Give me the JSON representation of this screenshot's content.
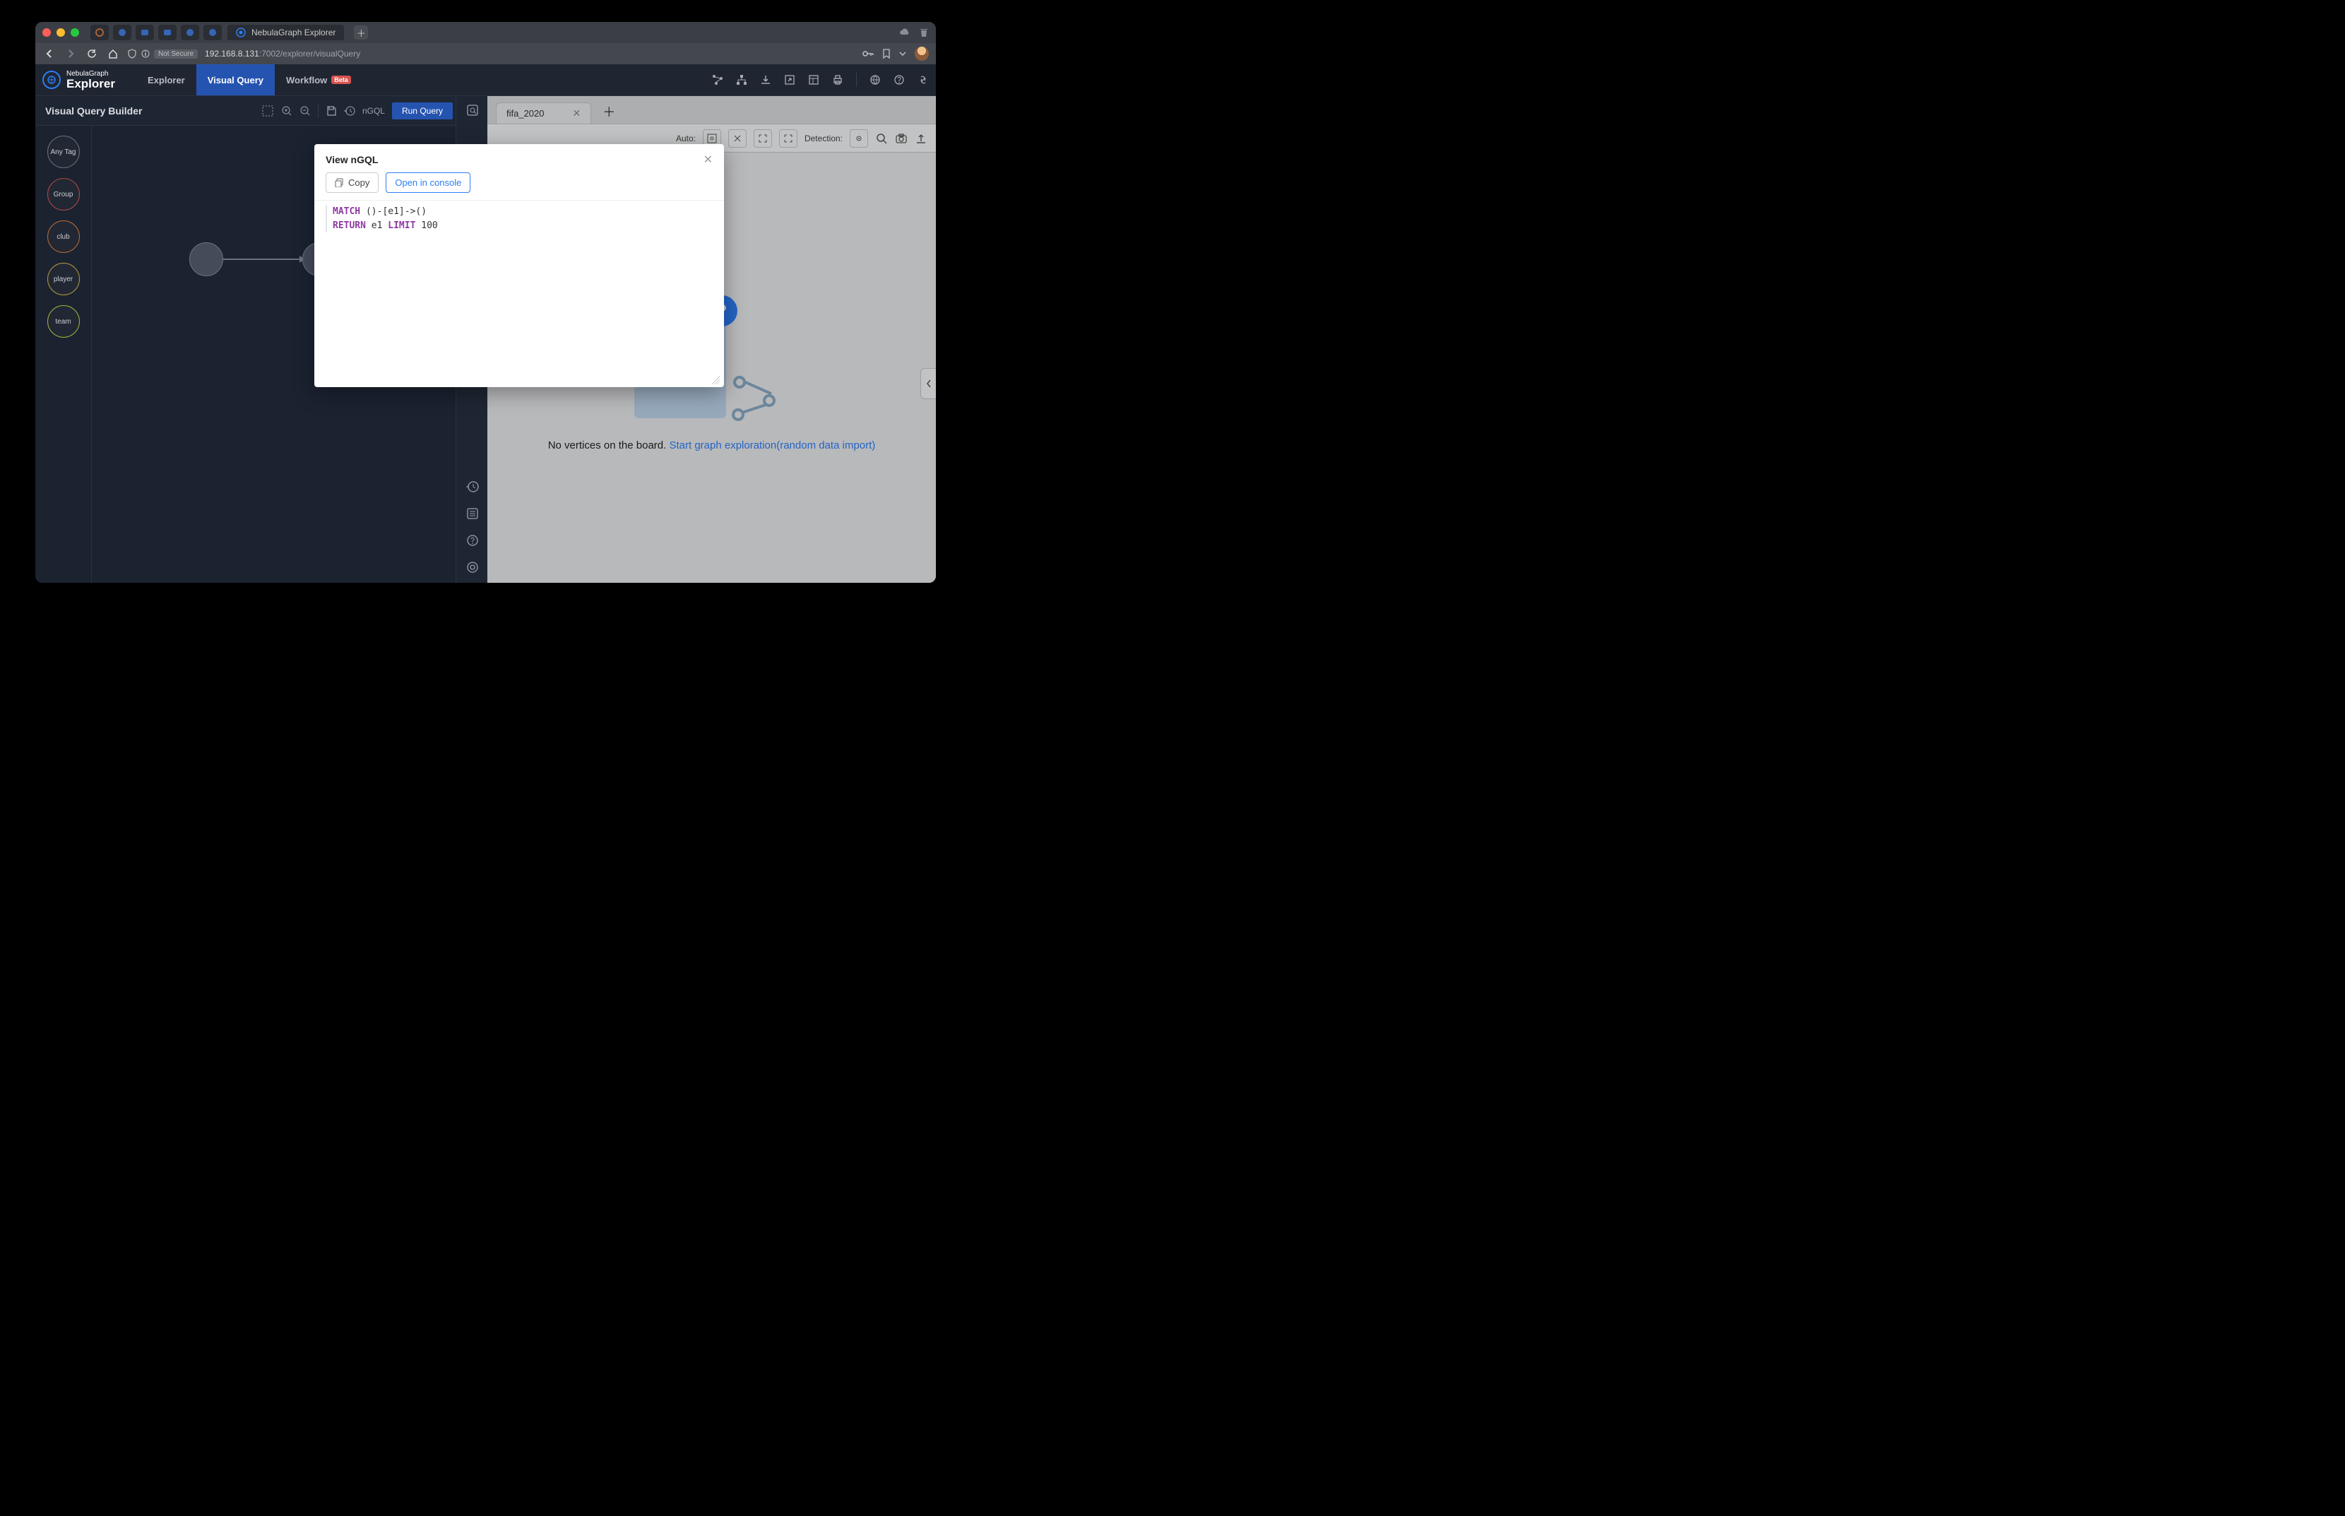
{
  "browser": {
    "tab_title": "NebulaGraph Explorer",
    "not_secure": "Not Secure",
    "url_host": "192.168.8.131",
    "url_port_path": ":7002/explorer/visualQuery"
  },
  "app": {
    "brand_top": "NebulaGraph",
    "brand_bottom": "Explorer",
    "tabs": {
      "explorer": "Explorer",
      "visual_query": "Visual Query",
      "workflow": "Workflow",
      "beta": "Beta"
    }
  },
  "builder": {
    "title": "Visual Query Builder",
    "ngql_label": "nGQL",
    "run_label": "Run Query",
    "tags": [
      "Any Tag",
      "Group",
      "club",
      "player",
      "team"
    ]
  },
  "board": {
    "tab": "fifa_2020",
    "auto_label": "Auto:",
    "detect_label": "Detection:",
    "empty_text": "No vertices on the board. ",
    "empty_link": "Start graph exploration(random data import)",
    "q": "?"
  },
  "modal": {
    "title": "View nGQL",
    "copy": "Copy",
    "open": "Open in console",
    "code": {
      "l1_kw": "MATCH",
      "l1_rest": " ()-[e1]->()",
      "l2_kw1": "RETURN",
      "l2_mid": " e1 ",
      "l2_kw2": "LIMIT",
      "l2_rest": " 100"
    }
  }
}
